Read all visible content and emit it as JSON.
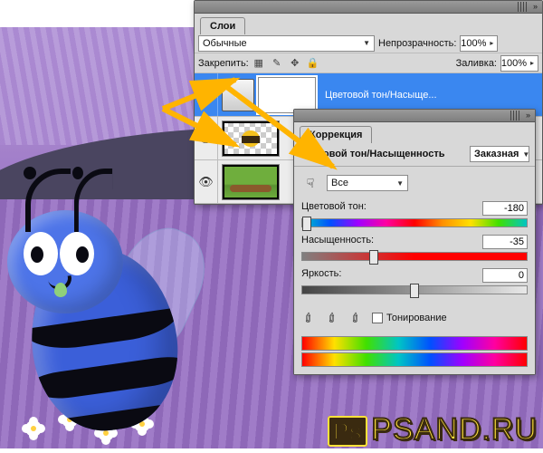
{
  "layers_panel": {
    "title": "Слои",
    "blend_mode": "Обычные",
    "opacity_label": "Непрозрачность:",
    "opacity_value": "100%",
    "lock_label": "Закрепить:",
    "fill_label": "Заливка:",
    "fill_value": "100%",
    "rows": [
      {
        "name": "Цветовой тон/Насыще..."
      },
      {
        "name": ""
      },
      {
        "name": ""
      }
    ]
  },
  "adjust_panel": {
    "title": "Коррекция",
    "subtitle": "Цветовой тон/Насыщенность",
    "preset": "Заказная",
    "range": "Все",
    "hue_label": "Цветовой тон:",
    "hue_value": "-180",
    "sat_label": "Насыщенность:",
    "sat_value": "-35",
    "light_label": "Яркость:",
    "light_value": "0",
    "colorize_label": "Тонирование"
  },
  "watermark": "PSAND.RU"
}
